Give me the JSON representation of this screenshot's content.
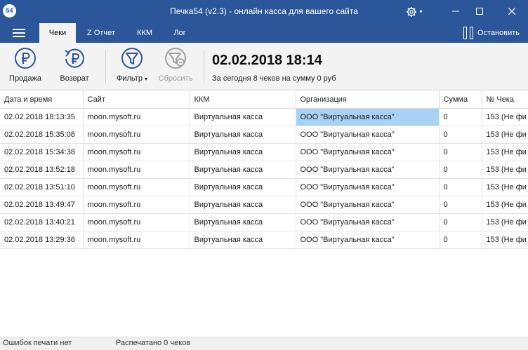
{
  "window": {
    "title": "Печка54 (v2.3) - онлайн касса для вашего сайта",
    "app_icon_text": "54",
    "accent": "#2b579a"
  },
  "menu": {
    "tabs": [
      {
        "label": "Чеки",
        "active": true
      },
      {
        "label": "Z Отчет",
        "active": false
      },
      {
        "label": "ККМ",
        "active": false
      },
      {
        "label": "Лог",
        "active": false
      }
    ],
    "stop_label": "Остановить"
  },
  "toolbar": {
    "sale_label": "Продажа",
    "return_label": "Возврат",
    "filter_label": "Фильтр",
    "reset_label": "Сбросить",
    "datetime": "02.02.2018 18:14",
    "summary": "За сегодня 8 чеков на сумму 0 руб"
  },
  "table": {
    "columns": [
      "Дата и время",
      "Сайт",
      "ККМ",
      "Организация",
      "Сумма",
      "№ Чека"
    ],
    "rows": [
      [
        "02.02.2018 18:13:35",
        "moon.mysoft.ru",
        "Виртуальная касса",
        "ООО \"Виртуальная касса\"",
        "0",
        "153 (Не фи"
      ],
      [
        "02.02.2018 15:35:08",
        "moon.mysoft.ru",
        "Виртуальная касса",
        "ООО \"Виртуальная касса\"",
        "0",
        "153 (Не фи"
      ],
      [
        "02.02.2018 15:34:38",
        "moon.mysoft.ru",
        "Виртуальная касса",
        "ООО \"Виртуальная касса\"",
        "0",
        "153 (Не фи"
      ],
      [
        "02.02.2018 13:52:18",
        "moon.mysoft.ru",
        "Виртуальная касса",
        "ООО \"Виртуальная касса\"",
        "0",
        "153 (Не фи"
      ],
      [
        "02.02.2018 13:51:10",
        "moon.mysoft.ru",
        "Виртуальная касса",
        "ООО \"Виртуальная касса\"",
        "0",
        "153 (Не фи"
      ],
      [
        "02.02.2018 13:49:47",
        "moon.mysoft.ru",
        "Виртуальная касса",
        "ООО \"Виртуальная касса\"",
        "0",
        "153 (Не фи"
      ],
      [
        "02.02.2018 13:40:21",
        "moon.mysoft.ru",
        "Виртуальная касса",
        "ООО \"Виртуальная касса\"",
        "0",
        "153 (Не фи"
      ],
      [
        "02.02.2018 13:29:36",
        "moon.mysoft.ru",
        "Виртуальная касса",
        "ООО \"Виртуальная касса\"",
        "0",
        "153 (Не фи"
      ]
    ],
    "selected_row": 0,
    "selected_col": 3
  },
  "status": {
    "errors": "Ошибок печати нет",
    "printed": "Распечатано 0 чеков"
  }
}
